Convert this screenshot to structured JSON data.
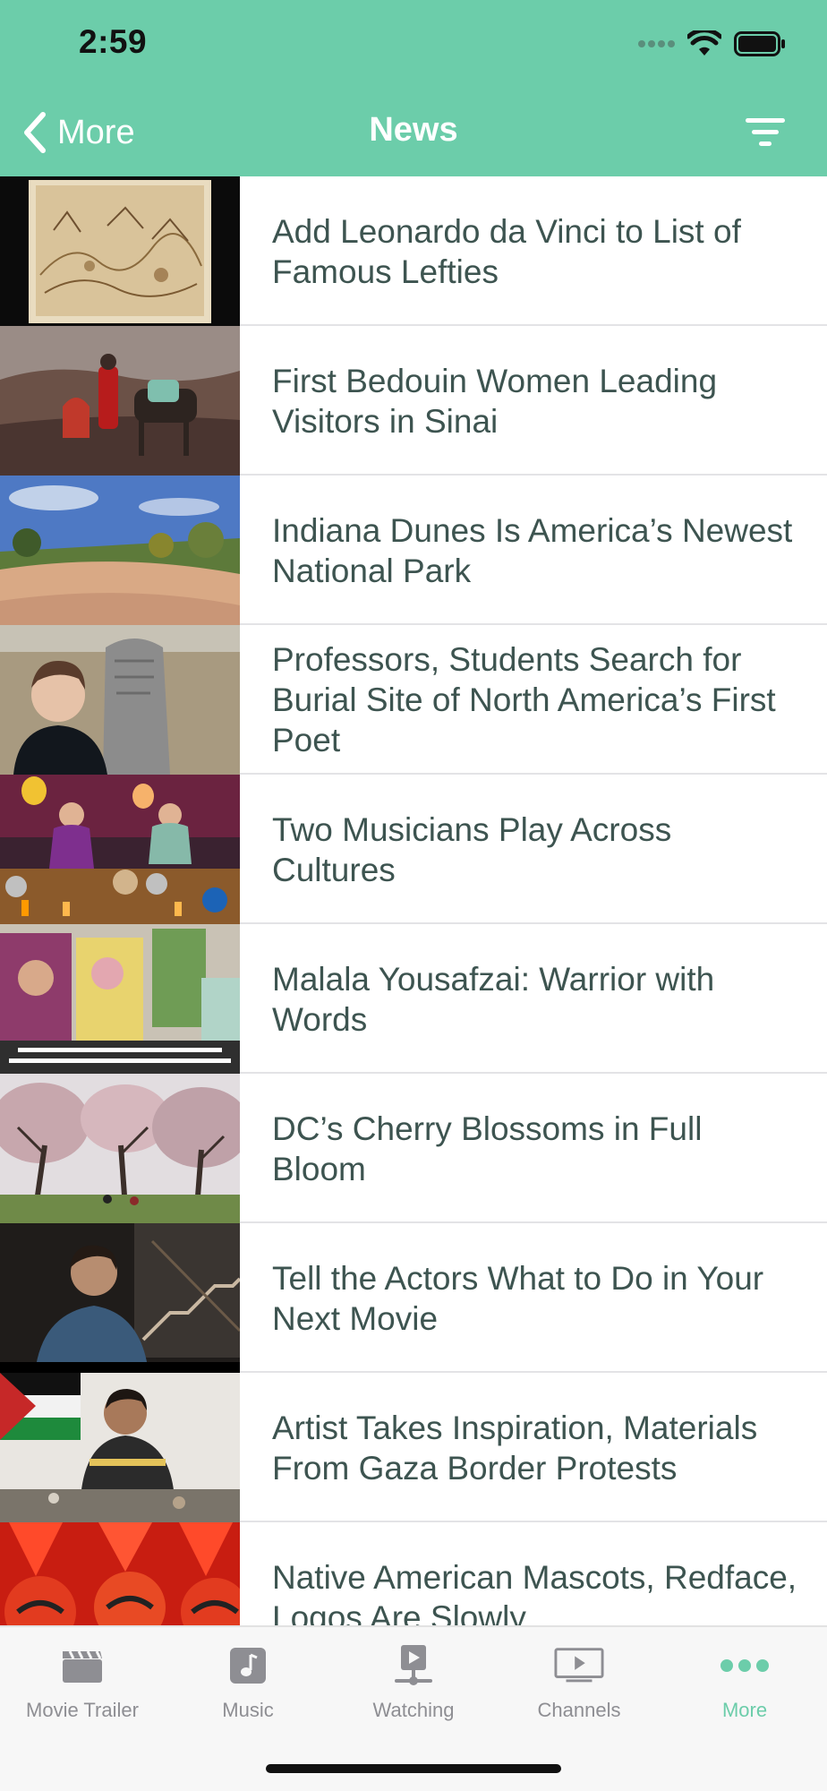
{
  "status_bar": {
    "time": "2:59"
  },
  "nav": {
    "back_label": "More",
    "title": "News"
  },
  "colors": {
    "accent": "#6ccdaa",
    "title_text": "#3d5450",
    "inactive": "#8e8e93"
  },
  "news": [
    {
      "title": "Add Leonardo da Vinci to List of Famous Lefties"
    },
    {
      "title": "First Bedouin Women Leading Visitors in Sinai"
    },
    {
      "title": "Indiana Dunes Is America’s Newest National Park"
    },
    {
      "title": "Professors, Students Search for Burial Site of North America’s First Poet"
    },
    {
      "title": "Two Musicians Play Across Cultures"
    },
    {
      "title": "Malala Yousafzai: Warrior with Words"
    },
    {
      "title": "DC’s Cherry Blossoms in Full Bloom"
    },
    {
      "title": "Tell the Actors What to Do in Your Next Movie"
    },
    {
      "title": "Artist Takes Inspiration, Materials From Gaza Border Protests"
    },
    {
      "title": "Native American Mascots, Redface, Logos Are Slowly"
    }
  ],
  "tabs": [
    {
      "label": "Movie Trailer",
      "icon": "clapperboard-icon"
    },
    {
      "label": "Music",
      "icon": "music-note-icon"
    },
    {
      "label": "Watching",
      "icon": "play-screen-icon"
    },
    {
      "label": "Channels",
      "icon": "tv-play-icon"
    },
    {
      "label": "More",
      "icon": "more-dots-icon",
      "active": true
    }
  ]
}
